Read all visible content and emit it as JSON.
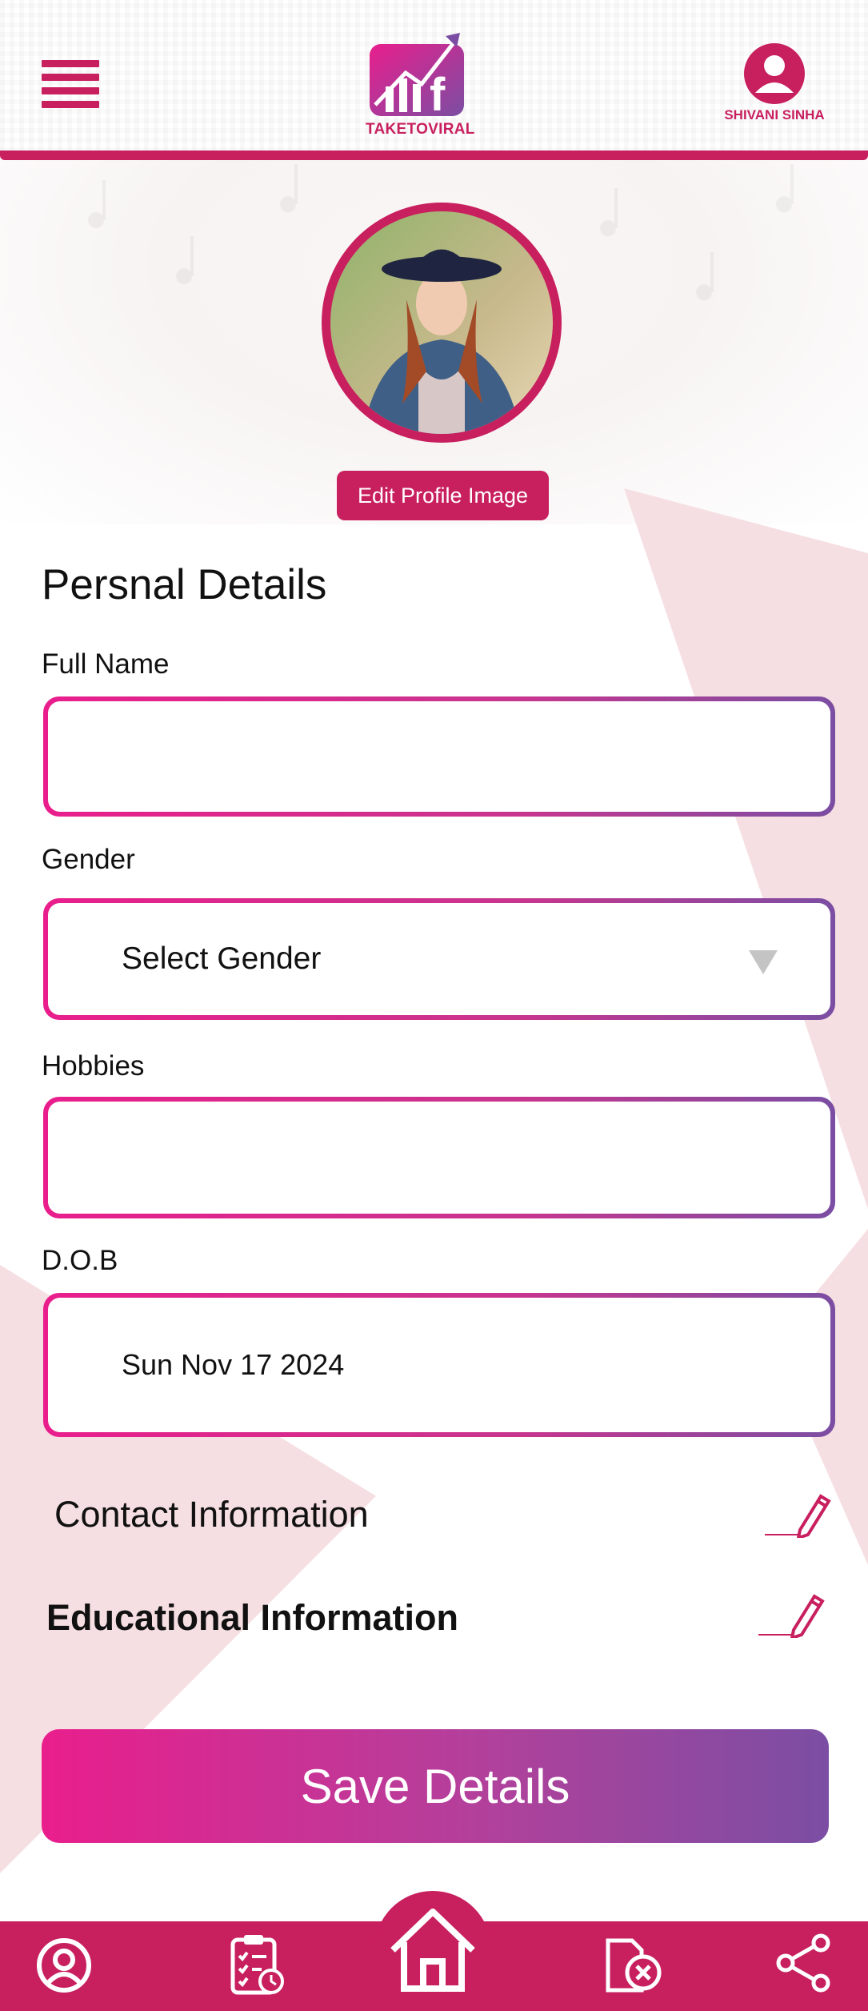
{
  "header": {
    "logo_text": "TAKETOVIRAL",
    "user_name": "SHIVANI SINHA"
  },
  "profile": {
    "edit_image_label": "Edit Profile Image"
  },
  "personal_details": {
    "title": "Persnal Details",
    "full_name": {
      "label": "Full Name",
      "value": ""
    },
    "gender": {
      "label": "Gender",
      "selected": "Select Gender"
    },
    "hobbies": {
      "label": "Hobbies",
      "value": ""
    },
    "dob": {
      "label": "D.O.B",
      "value": "Sun Nov 17 2024"
    }
  },
  "sections": {
    "contact": "Contact Information",
    "education": "Educational Information"
  },
  "save_button": "Save Details",
  "bottom_nav": {
    "items": [
      "profile-icon",
      "schedule-list-icon",
      "home-icon",
      "cancel-document-icon",
      "share-icon"
    ]
  },
  "colors": {
    "brand": "#c81f5e",
    "gradient_start": "#e91e8c",
    "gradient_end": "#7b4ea3",
    "bg_accent": "#f6dfe2"
  }
}
